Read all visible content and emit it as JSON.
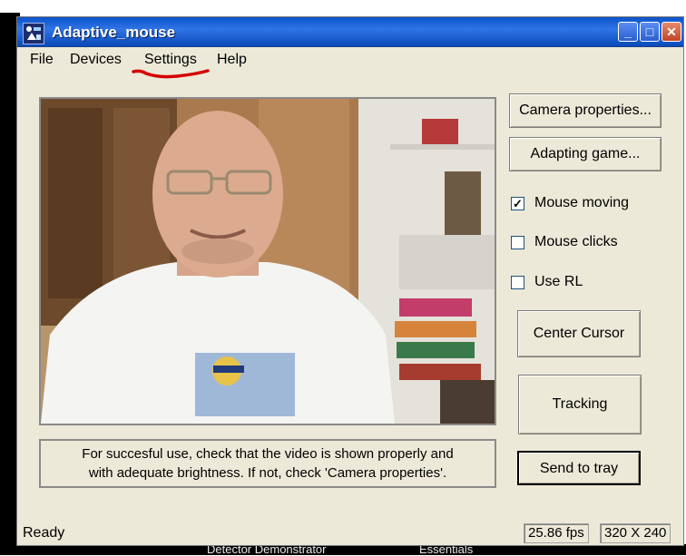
{
  "window": {
    "title": "Adaptive_mouse",
    "controls": {
      "minimize": "_",
      "maximize": "□",
      "close": "✕"
    }
  },
  "menu": [
    {
      "label": "File"
    },
    {
      "label": "Devices"
    },
    {
      "label": "Settings"
    },
    {
      "label": "Help"
    }
  ],
  "buttons": {
    "camera_properties": "Camera properties...",
    "adapting_game": "Adapting game...",
    "center_cursor": "Center Cursor",
    "tracking": "Tracking",
    "send_to_tray": "Send to tray"
  },
  "checkboxes": [
    {
      "label": "Mouse moving",
      "checked": true
    },
    {
      "label": "Mouse clicks",
      "checked": false
    },
    {
      "label": "Use RL",
      "checked": false
    }
  ],
  "info": {
    "line1": "For succesful use, check that the video is shown properly and",
    "line2": "with adequate brightness. If not, check 'Camera properties'."
  },
  "status": {
    "text": "Ready",
    "fps": "25.86 fps",
    "resolution": "320 X 240"
  },
  "desktop": {
    "bottom_left": "Detector Demonstrator",
    "bottom_right": "Essentials"
  },
  "colors": {
    "titlebar": "#0b53c9",
    "window_bg": "#ece9d8",
    "annotation": "#d40000"
  }
}
